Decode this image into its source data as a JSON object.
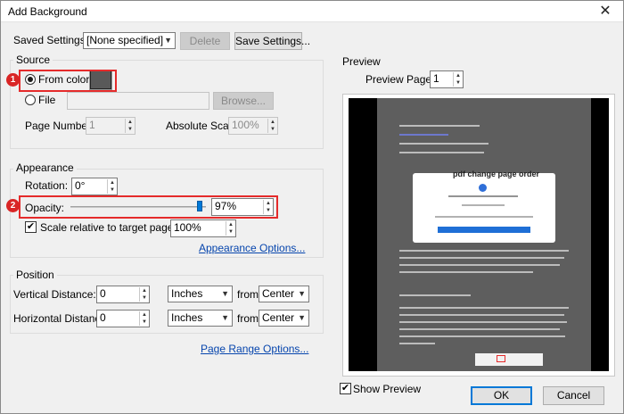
{
  "window": {
    "title": "Add Background",
    "close_glyph": "✕"
  },
  "saved_settings": {
    "label": "Saved Settings:",
    "value": "[None specified]",
    "delete_label": "Delete",
    "save_label": "Save Settings..."
  },
  "source": {
    "title": "Source",
    "from_color_label": "From color",
    "from_color_swatch": "#595959",
    "file_label": "File",
    "browse_label": "Browse...",
    "page_number_label": "Page Number:",
    "page_number_value": "1",
    "absolute_scale_label": "Absolute Scale:",
    "absolute_scale_value": "100%"
  },
  "appearance": {
    "title": "Appearance",
    "rotation_label": "Rotation:",
    "rotation_value": "0°",
    "opacity_label": "Opacity:",
    "opacity_value": "97%",
    "opacity_level": 0.97,
    "scale_relative_label": "Scale relative to target page",
    "scale_relative_checked": true,
    "scale_value": "100%",
    "options_link": "Appearance Options..."
  },
  "position": {
    "title": "Position",
    "vertical_label": "Vertical Distance:",
    "vertical_value": "0",
    "vertical_unit": "Inches",
    "vertical_from_label": "from",
    "vertical_from": "Center",
    "horizontal_label": "Horizontal Distance:",
    "horizontal_value": "0",
    "horizontal_unit": "Inches",
    "horizontal_from_label": "from",
    "horizontal_from": "Center"
  },
  "page_range_link": "Page Range Options...",
  "preview": {
    "title": "Preview",
    "preview_page_label": "Preview Page:",
    "preview_page_value": "1",
    "modal_title": "pdf change page order",
    "show_preview_label": "Show Preview",
    "show_preview_checked": true
  },
  "buttons": {
    "ok": "OK",
    "cancel": "Cancel"
  },
  "annotations": {
    "badge1": "1",
    "badge2": "2"
  },
  "colors": {
    "annotation_red": "#e52b2b",
    "link_blue": "#0645ad",
    "accent": "#0078d7"
  }
}
